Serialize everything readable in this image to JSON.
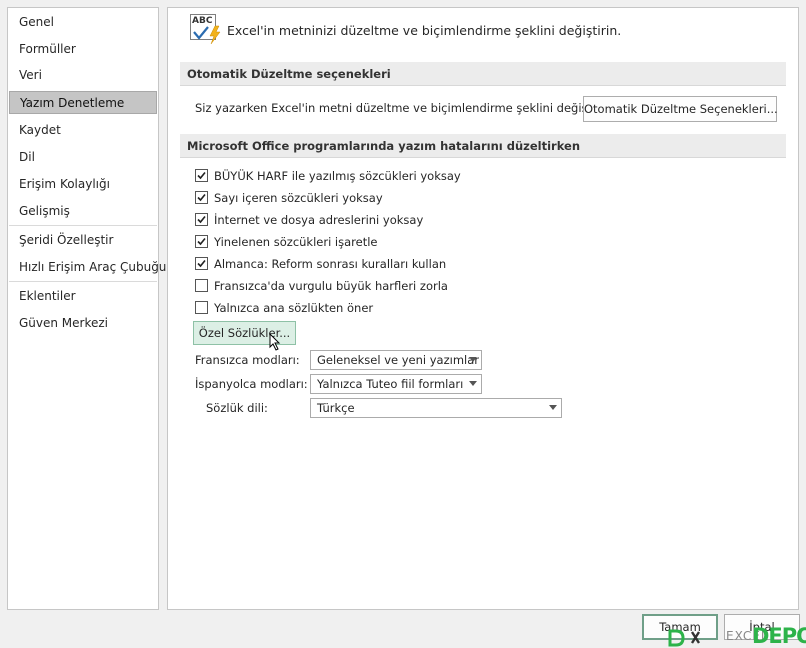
{
  "sidebar": {
    "items": [
      {
        "label": "Genel"
      },
      {
        "label": "Formüller"
      },
      {
        "label": "Veri"
      },
      {
        "label": "Yazım Denetleme",
        "selected": true
      },
      {
        "label": "Kaydet"
      },
      {
        "label": "Dil"
      },
      {
        "label": "Erişim Kolaylığı"
      },
      {
        "label": "Gelişmiş"
      },
      {
        "label": "Şeridi Özelleştir"
      },
      {
        "label": "Hızlı Erişim Araç Çubuğu"
      },
      {
        "label": "Eklentiler"
      },
      {
        "label": "Güven Merkezi"
      }
    ]
  },
  "main": {
    "intro_icon": "abc-check-icon",
    "intro_text": "Excel'in metninizi düzeltme ve biçimlendirme şeklini değiştirin.",
    "autocorrect": {
      "header": "Otomatik Düzeltme seçenekleri",
      "description": "Siz yazarken Excel'in metni düzeltme ve biçimlendirme şeklini değiştirin:",
      "button_label": "Otomatik Düzeltme Seçenekleri..."
    },
    "spelling": {
      "header": "Microsoft Office programlarında yazım hatalarını düzeltirken",
      "options": [
        {
          "label": "BÜYÜK HARF ile yazılmış sözcükleri yoksay",
          "checked": true
        },
        {
          "label": "Sayı içeren sözcükleri yoksay",
          "checked": true
        },
        {
          "label": "İnternet ve dosya adreslerini yoksay",
          "checked": true
        },
        {
          "label": "Yinelenen sözcükleri işaretle",
          "checked": true
        },
        {
          "label": "Almanca: Reform sonrası kuralları kullan",
          "checked": true
        },
        {
          "label": "Fransızca'da vurgulu büyük harfleri zorla",
          "checked": false
        },
        {
          "label": "Yalnızca ana sözlükten öner",
          "checked": false
        }
      ],
      "custom_dict_button": "Özel Sözlükler...",
      "french_modes": {
        "label": "Fransızca modları:",
        "value": "Geleneksel ve yeni yazımlar"
      },
      "spanish_modes": {
        "label": "İspanyolca modları:",
        "value": "Yalnızca Tuteo fiil formları"
      },
      "dictionary_language": {
        "label": "Sözlük dili:",
        "value": "Türkçe"
      }
    }
  },
  "footer": {
    "ok_label": "Tamam",
    "cancel_label": "İptal"
  },
  "watermark": {
    "excel": "EXCEL",
    "depo": "DEPO"
  },
  "colors": {
    "selected_nav_bg": "#c5c5c5",
    "hover_button_bg": "#dcefe5",
    "watermark_green": "#2db34a"
  }
}
